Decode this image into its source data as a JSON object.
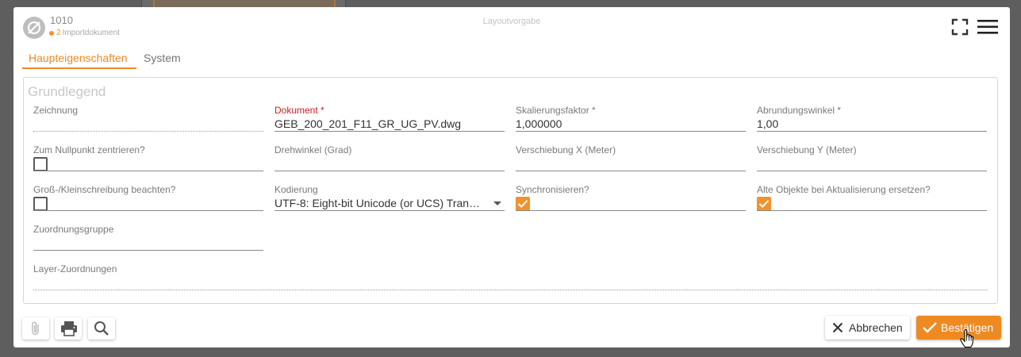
{
  "header": {
    "id": "1010",
    "badge_count": "2",
    "subtitle": "Importdokument",
    "title": "Layoutvorgabe"
  },
  "tabs": [
    {
      "label": "Haupteigenschaften",
      "active": true
    },
    {
      "label": "System",
      "active": false
    }
  ],
  "group": {
    "legend": "Grundlegend"
  },
  "fields": {
    "zeichnung": {
      "label": "Zeichnung",
      "value": ""
    },
    "dokument": {
      "label": "Dokument *",
      "value": "GEB_200_201_F11_GR_UG_PV.dwg"
    },
    "skalierungsfaktor": {
      "label": "Skalierungsfaktor *",
      "value": "1,000000"
    },
    "abrundungswinkel": {
      "label": "Abrundungswinkel *",
      "value": "1,00"
    },
    "nullpunkt": {
      "label": "Zum Nullpunkt zentrieren?",
      "checked": false
    },
    "drehwinkel": {
      "label": "Drehwinkel (Grad)",
      "value": ""
    },
    "verschiebung_x": {
      "label": "Verschiebung X (Meter)",
      "value": ""
    },
    "verschiebung_y": {
      "label": "Verschiebung Y (Meter)",
      "value": ""
    },
    "gross_klein": {
      "label": "Groß-/Kleinschreibung beachten?",
      "checked": false
    },
    "kodierung": {
      "label": "Kodierung",
      "value": "UTF-8: Eight-bit Unicode (or UCS) Transf..."
    },
    "synchronisieren": {
      "label": "Synchronisieren?",
      "checked": true
    },
    "alte_objekte": {
      "label": "Alte Objekte bei Aktualisierung ersetzen?",
      "checked": true
    },
    "zuordnungsgruppe": {
      "label": "Zuordnungsgruppe",
      "value": ""
    },
    "layer_zuordnungen": {
      "label": "Layer-Zuordnungen",
      "value": ""
    }
  },
  "footer": {
    "cancel_label": "Abbrechen",
    "confirm_label": "Bestätigen"
  },
  "colors": {
    "accent": "#ee8a22",
    "required_label": "#cc1f1f"
  },
  "icons": [
    "no-image-icon",
    "fullscreen-icon",
    "hamburger-menu-icon",
    "paperclip-icon",
    "printer-icon",
    "search-icon",
    "close-icon",
    "checkmark-icon",
    "hand-cursor-icon"
  ]
}
